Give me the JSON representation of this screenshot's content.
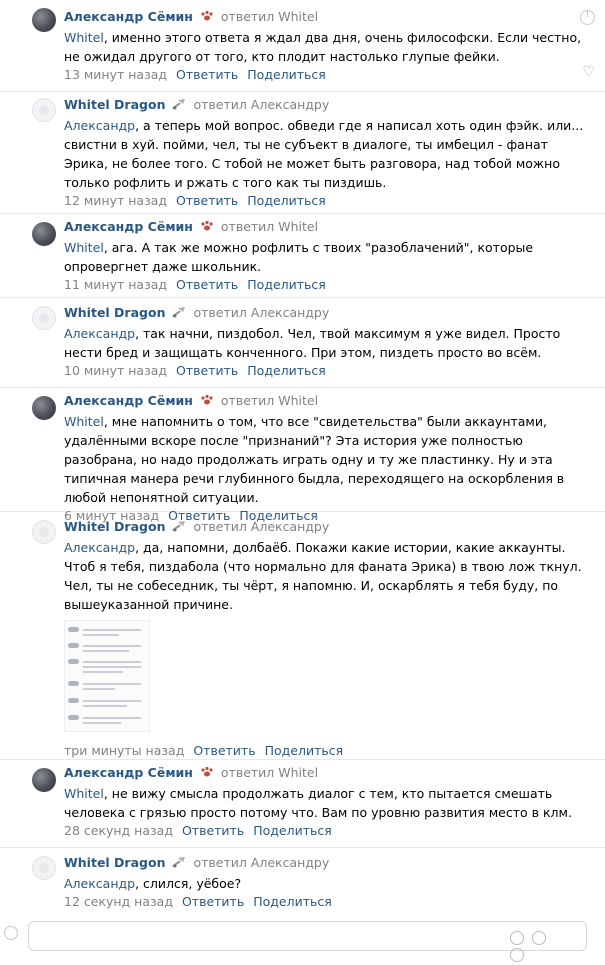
{
  "comments": [
    {
      "author": "Александр Сёмин",
      "replied": "ответил Whitel",
      "mention": "Whitel",
      "text": ", именно этого ответа я ждал два дня, очень философски. Если честно, не ожидал другого от того, кто плодит настолько глупые фейки.",
      "time": "13 минут назад",
      "reply": "Ответить",
      "share": "Поделиться"
    },
    {
      "author": "Whitel Dragon",
      "replied": "ответил Александру",
      "mention": "Александр",
      "text": ", а теперь мой вопрос. обведи где я написал хоть один фэйк. или... свистни в хуй. пойми, чел, ты не субъект в диалоге, ты имбецил - фанат Эрика, не более того. С тобой не может быть разговора, над тобой можно только рофлить и ржать с того как ты пиздишь.",
      "time": "12 минут назад",
      "reply": "Ответить",
      "share": "Поделиться"
    },
    {
      "author": "Александр Сёмин",
      "replied": "ответил Whitel",
      "mention": "Whitel",
      "text": ", ага. А так же можно рофлить с твоих \"разоблачений\", которые опровергнет даже школьник.",
      "time": "11 минут назад",
      "reply": "Ответить",
      "share": "Поделиться"
    },
    {
      "author": "Whitel Dragon",
      "replied": "ответил Александру",
      "mention": "Александр",
      "text": ", так начни, пиздобол. Чел, твой максимум я уже видел. Просто нести бред и защищать конченного. При этом, пиздеть просто во всём.",
      "time": "10 минут назад",
      "reply": "Ответить",
      "share": "Поделиться"
    },
    {
      "author": "Александр Сёмин",
      "replied": "ответил Whitel",
      "mention": "Whitel",
      "text": ", мне напомнить о том, что все \"свидетельства\" были аккаунтами, удалёнными вскоре после \"признаний\"? Эта история уже полностью разобрана, но надо продолжать играть одну и ту же пластинку. Ну и эта типичная манера речи глубинного быдла, переходящего на оскорбления в любой непонятной ситуации.",
      "time": "6 минут назад",
      "reply": "Ответить",
      "share": "Поделиться"
    },
    {
      "author": "Whitel Dragon",
      "replied": "ответил Александру",
      "mention": "Александр",
      "text": ", да, напомни, долбаёб. Покажи какие истории, какие аккаунты. Чтоб я тебя, пиздабола (что нормально для фаната Эрика) в твою лож ткнул. Чел, ты не собеседник, ты чёрт, я напомню. И, оскарблять я тебя буду, по вышеуказанной причине.",
      "time": "три минуты назад",
      "reply": "Ответить",
      "share": "Поделиться"
    },
    {
      "author": "Александр Сёмин",
      "replied": "ответил Whitel",
      "mention": "Whitel",
      "text": ", не вижу смысла продолжать диалог с тем, кто пытается смешать человека с грязью просто потому что. Вам по уровню развития место в клм.",
      "time": "28 секунд назад",
      "reply": "Ответить",
      "share": "Поделиться"
    },
    {
      "author": "Whitel Dragon",
      "replied": "ответил Александру",
      "mention": "Александр",
      "text": ", слился, уёбое?",
      "time": "12 секунд назад",
      "reply": "Ответить",
      "share": "Поделиться"
    }
  ],
  "icons": {
    "report": "report-icon",
    "like": "heart-icon",
    "alex_badge": "paw-icon",
    "whitel_badge": "satellite-icon",
    "attach": "screenshot-thumbnail"
  },
  "colors": {
    "link": "#2a5885",
    "meta": "#828282",
    "divider": "#e7e8ec"
  }
}
